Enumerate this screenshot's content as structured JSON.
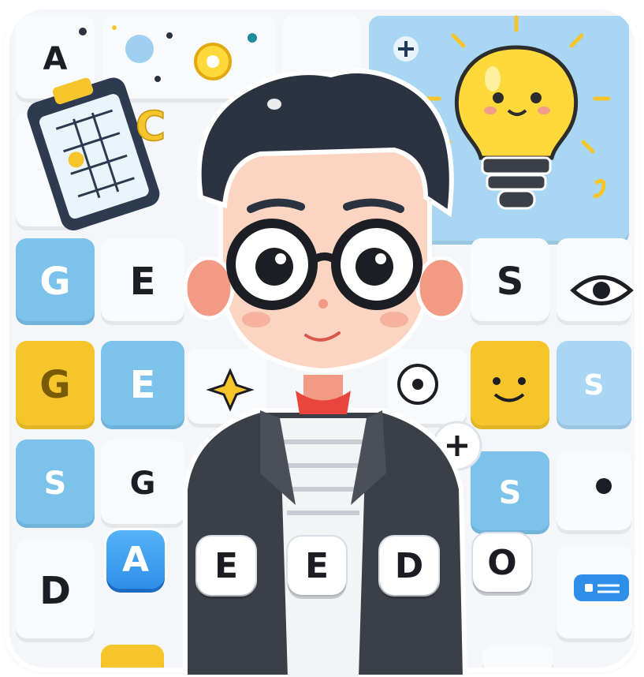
{
  "tiles": {
    "top_left_letter": "A",
    "top_c_letter": "C",
    "row2": [
      "G",
      "E",
      "S"
    ],
    "row3": [
      "G",
      "E",
      "S"
    ],
    "row4": [
      "S",
      "G",
      "S"
    ],
    "row5": [
      "D"
    ]
  },
  "letter_buttons": [
    "A",
    "E",
    "E",
    "D",
    "O"
  ],
  "colors": {
    "accent_blue": "#2f8fe8",
    "tile_blue": "#7cc3ec",
    "tile_yellow": "#f6c52b",
    "bulb_yellow": "#ffd93b",
    "jacket": "#3b3f47",
    "hair": "#2b3340"
  },
  "icons": [
    "lightbulb-icon",
    "clipboard-icon",
    "eye-icon",
    "smiley-icon",
    "plus-icon",
    "sparkle-icon",
    "menu-pill-icon"
  ]
}
